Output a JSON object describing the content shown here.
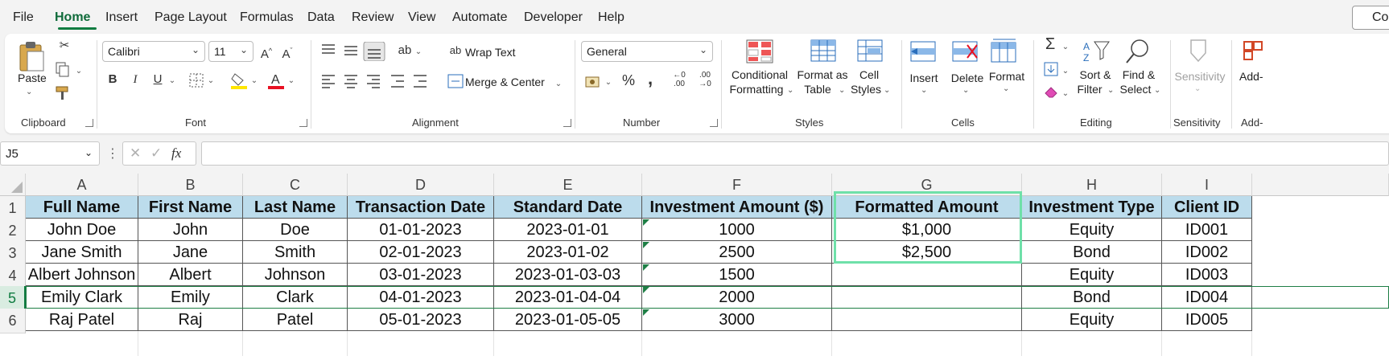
{
  "menu": {
    "items": [
      "File",
      "Home",
      "Insert",
      "Page Layout",
      "Formulas",
      "Data",
      "Review",
      "View",
      "Automate",
      "Developer",
      "Help"
    ],
    "active": "Home",
    "comments_label": "Co"
  },
  "ribbon": {
    "clipboard": {
      "paste": "Paste",
      "group": "Clipboard"
    },
    "font": {
      "name": "Calibri",
      "size": "11",
      "group": "Font",
      "bold": "B",
      "italic": "I",
      "underline": "U"
    },
    "alignment": {
      "wrap_text": "Wrap Text",
      "merge_center": "Merge & Center",
      "group": "Alignment"
    },
    "number": {
      "format": "General",
      "percent": "%",
      "comma": ",",
      "group": "Number"
    },
    "styles": {
      "conditional_line1": "Conditional",
      "conditional_line2": "Formatting",
      "format_table_line1": "Format as",
      "format_table_line2": "Table",
      "cell_styles_line1": "Cell",
      "cell_styles_line2": "Styles",
      "group": "Styles"
    },
    "cells": {
      "insert": "Insert",
      "delete": "Delete",
      "format": "Format",
      "group": "Cells"
    },
    "editing": {
      "sort_line1": "Sort &",
      "sort_line2": "Filter",
      "find_line1": "Find &",
      "find_line2": "Select",
      "group": "Editing"
    },
    "sensitivity": {
      "label": "Sensitivity",
      "group": "Sensitivity"
    },
    "addins": {
      "label": "Add-",
      "group": "Add-"
    }
  },
  "formula_bar": {
    "name_box": "J5",
    "fx": "fx",
    "value": ""
  },
  "sheet": {
    "columns": [
      "A",
      "B",
      "C",
      "D",
      "E",
      "F",
      "G",
      "H",
      "I"
    ],
    "rows": [
      "1",
      "2",
      "3",
      "4",
      "5",
      "6"
    ],
    "selected_row": "5",
    "headers": [
      "Full Name",
      "First Name",
      "Last Name",
      "Transaction Date",
      "Standard Date",
      "Investment Amount ($)",
      "Formatted Amount",
      "Investment Type",
      "Client ID"
    ],
    "data": [
      [
        "John Doe",
        "John",
        "Doe",
        "01-01-2023",
        "2023-01-01",
        "1000",
        "$1,000",
        "Equity",
        "ID001"
      ],
      [
        "Jane Smith",
        "Jane",
        "Smith",
        "02-01-2023",
        "2023-01-02",
        "2500",
        "$2,500",
        "Bond",
        "ID002"
      ],
      [
        "Albert Johnson",
        "Albert",
        "Johnson",
        "03-01-2023",
        "2023-01-03-03",
        "1500",
        "",
        "Equity",
        "ID003"
      ],
      [
        "Emily Clark",
        "Emily",
        "Clark",
        "04-01-2023",
        "2023-01-04-04",
        "2000",
        "",
        "Bond",
        "ID004"
      ],
      [
        "Raj Patel",
        "Raj",
        "Patel",
        "05-01-2023",
        "2023-01-05-05",
        "3000",
        "",
        "Equity",
        "ID005"
      ]
    ],
    "colors": {
      "header_fill": "#bcdcec",
      "selection": "#6fe0a9",
      "accent": "#107c41"
    }
  }
}
